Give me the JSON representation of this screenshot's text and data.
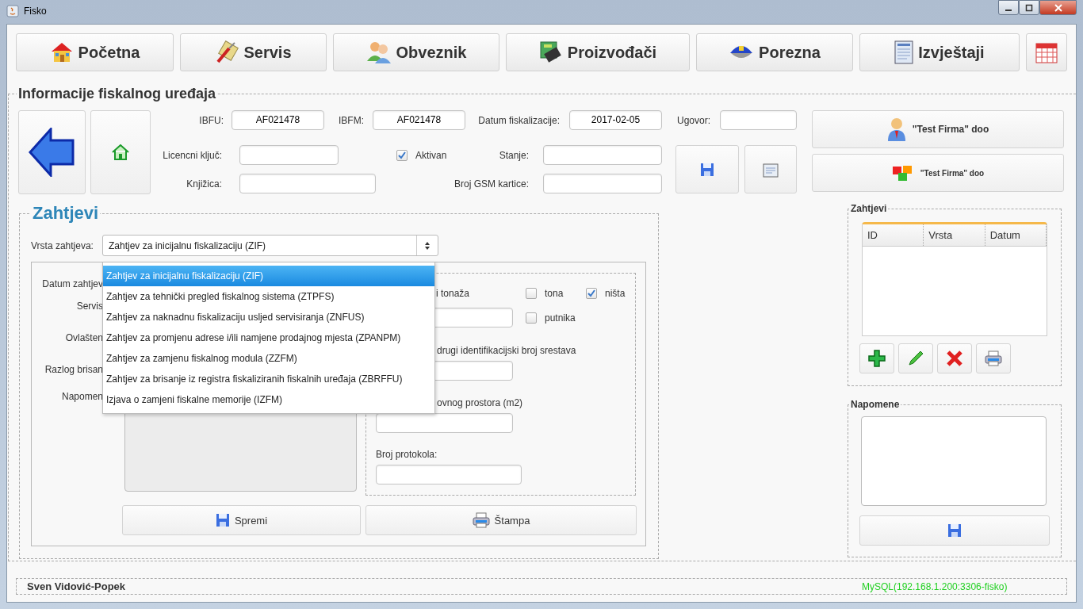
{
  "window": {
    "title": "Fisko"
  },
  "nav": [
    {
      "label": "Početna"
    },
    {
      "label": "Servis"
    },
    {
      "label": "Obveznik"
    },
    {
      "label": "Proizvođači"
    },
    {
      "label": "Porezna"
    },
    {
      "label": "Izvještaji"
    }
  ],
  "device_info": {
    "title": "Informacije fiskalnog uređaja",
    "ibfu": {
      "label": "IBFU:",
      "value": "AF021478"
    },
    "ibfm": {
      "label": "IBFM:",
      "value": "AF021478"
    },
    "datum": {
      "label": "Datum fiskalizacije:",
      "value": "2017-02-05"
    },
    "ugovor": {
      "label": "Ugovor:"
    },
    "licencni": {
      "label": "Licencni ključ:"
    },
    "aktivan": {
      "label": "Aktivan",
      "checked": true
    },
    "stanje": {
      "label": "Stanje:"
    },
    "knjizica": {
      "label": "Knjižica:"
    },
    "gsm": {
      "label": "Broj GSM kartice:"
    }
  },
  "company_buttons": [
    {
      "label": "\"Test Firma\" doo"
    },
    {
      "label": "\"Test Firma\" doo"
    }
  ],
  "requests": {
    "title": "Zahtjevi",
    "type_label": "Vrsta zahtjeva:",
    "type_value": "Zahtjev za inicijalnu fiskalizaciju (ZIF)",
    "dropdown": {
      "expanded": true,
      "options": [
        {
          "label": "Zahtjev za inicijalnu fiskalizaciju (ZIF)",
          "selected": true
        },
        {
          "label": "Zahtjev za tehnički pregled fiskalnog sistema (ZTPFS)",
          "selected": false
        },
        {
          "label": "Zahtjev za naknadnu fiskalizaciju usljed servisiranja (ZNFUS)",
          "selected": false
        },
        {
          "label": "Zahtjev za promjenu adrese i/ili namjene prodajnog mjesta (ZPANPM)",
          "selected": false
        },
        {
          "label": "Zahtjev za zamjenu fiskalnog modula (ZZFM)",
          "selected": false
        },
        {
          "label": "Zahtjev za brisanje iz registra fiskaliziranih fiskalnih uređaja (ZBRFFU)",
          "selected": false
        },
        {
          "label": "Izjava o zamjeni fiskalne memorije (IZFM)",
          "selected": false
        }
      ]
    },
    "left_labels": [
      "Datum zahtjev",
      "Servis",
      "Ovlašten",
      "Razlog brisan",
      "Napomen"
    ],
    "load_label": "i tonaža",
    "checks": [
      {
        "label": "tona",
        "checked": false
      },
      {
        "label": "ništa",
        "checked": true
      },
      {
        "label": "putnika",
        "checked": false
      }
    ],
    "reg_label": "drugi identifikacijski broj srestava",
    "area_label": "ovnog prostora (m2)",
    "protocol_label": "Broj protokola:",
    "buttons": [
      {
        "label": "Spremi"
      },
      {
        "label": "Štampa"
      }
    ]
  },
  "side_requests": {
    "title": "Zahtjevi",
    "columns": [
      "ID",
      "Vrsta",
      "Datum"
    ]
  },
  "notes": {
    "title": "Napomene"
  },
  "status_bar": {
    "user": "Sven Vidović-Popek",
    "connection": "MySQL(192.168.1.200:3306-fisko)"
  }
}
